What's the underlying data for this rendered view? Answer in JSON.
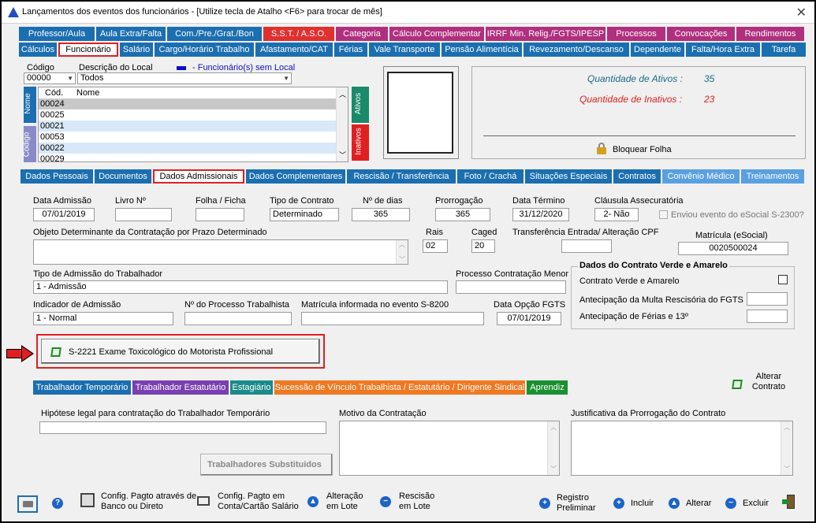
{
  "window": {
    "title": "Lançamentos dos eventos dos funcionários - [Utilize tecla de Atalho <F6> para trocar de mês]"
  },
  "tabs_row1": [
    {
      "label": "Professor/Aula",
      "color": "#1b6fb0"
    },
    {
      "label": "Aula Extra/Falta",
      "color": "#1b6fb0"
    },
    {
      "label": "Com./Pre./Grat./Bon",
      "color": "#1b6fb0"
    },
    {
      "label": "S.S.T. / A.S.O.",
      "color": "#e03030"
    },
    {
      "label": "Categoria",
      "color": "#b0307f"
    },
    {
      "label": "Cálculo Complementar",
      "color": "#b0307f"
    },
    {
      "label": "IRRF Min. Relig./FGTS/IPESP",
      "color": "#b0307f"
    },
    {
      "label": "Processos",
      "color": "#b0307f"
    },
    {
      "label": "Convocações",
      "color": "#b0307f"
    },
    {
      "label": "Rendimentos",
      "color": "#b0307f"
    }
  ],
  "tabs_row2": [
    {
      "label": "Cálculos",
      "color": "#1b6fb0"
    },
    {
      "label": "Funcionário",
      "color": "#1b6fb0",
      "active": true
    },
    {
      "label": "Salário",
      "color": "#1b6fb0"
    },
    {
      "label": "Cargo/Horário Trabalho",
      "color": "#1b6fb0"
    },
    {
      "label": "Afastamento/CAT",
      "color": "#1b6fb0"
    },
    {
      "label": "Férias",
      "color": "#1b6fb0"
    },
    {
      "label": "Vale Transporte",
      "color": "#1b6fb0"
    },
    {
      "label": "Pensão Alimentícia",
      "color": "#1b6fb0"
    },
    {
      "label": "Revezamento/Descanso",
      "color": "#1b6fb0"
    },
    {
      "label": "Dependente",
      "color": "#1b6fb0"
    },
    {
      "label": "Falta/Hora Extra",
      "color": "#1b6fb0"
    },
    {
      "label": "Tarefa",
      "color": "#1b6fb0"
    }
  ],
  "employee_list": {
    "codigo_label": "Código",
    "codigo_value": "00000",
    "local_label": "Descrição do Local",
    "local_value": "Todos",
    "legend": "- Funcionário(s) sem Local",
    "col_cod": "Cód.",
    "col_nome": "Nome",
    "side_nome": "Nome",
    "side_codigo": "Código",
    "side_ativos": "Ativos",
    "side_inativos": "Inativos",
    "rows": [
      "00024",
      "00025",
      "00021",
      "00053",
      "00022",
      "00029"
    ]
  },
  "stats": {
    "ativos_label": "Quantidade de Ativos :",
    "ativos_value": "35",
    "inativos_label": "Quantidade de Inativos :",
    "inativos_value": "23",
    "bloquear": "Bloquear Folha"
  },
  "subtabs": [
    {
      "label": "Dados Pessoais",
      "color": "#1b6fb0"
    },
    {
      "label": "Documentos",
      "color": "#1b6fb0"
    },
    {
      "label": "Dados Admissionais",
      "color": "#1b6fb0",
      "active": true
    },
    {
      "label": "Dados Complementares",
      "color": "#1b6fb0"
    },
    {
      "label": "Rescisão / Transferência",
      "color": "#1b6fb0"
    },
    {
      "label": "Foto / Crachá",
      "color": "#1b6fb0"
    },
    {
      "label": "Situações Especiais",
      "color": "#1b6fb0"
    },
    {
      "label": "Contratos",
      "color": "#1b6fb0"
    },
    {
      "label": "Convênio Médico",
      "color": "#5aa0e0"
    },
    {
      "label": "Treinamentos",
      "color": "#5aa0e0"
    }
  ],
  "form": {
    "data_admissao_label": "Data Admissão",
    "data_admissao": "07/01/2019",
    "livro_label": "Livro Nº",
    "livro": "",
    "folha_label": "Folha / Ficha",
    "folha": "",
    "tipo_contrato_label": "Tipo de Contrato",
    "tipo_contrato": "Determinado",
    "dias_label": "Nº de dias",
    "dias": "365",
    "prorrogacao_label": "Prorrogação",
    "prorrogacao": "365",
    "data_termino_label": "Data Término",
    "data_termino": "31/12/2020",
    "clausula_label": "Cláusula Assecuratória",
    "clausula": "2- Não",
    "enviou_label": "Enviou evento do eSocial S-2300?",
    "objeto_label": "Objeto Determinante da Contratação por Prazo Determinado",
    "rais_label": "Rais",
    "rais": "02",
    "caged_label": "Caged",
    "caged": "20",
    "transf_label": "Transferência Entrada/ Alteração CPF",
    "matricula_label": "Matrícula (eSocial)",
    "matricula": "0020500024",
    "tipo_admissao_label": "Tipo de Admissão do Trabalhador",
    "tipo_admissao": "1 - Admissão",
    "processo_menor_label": "Processo Contratação Menor",
    "indicador_label": "Indicador de Admissão",
    "indicador": "1 - Normal",
    "processo_trab_label": "Nº do Processo Trabalhista",
    "matricula_s8200_label": "Matrícula informada no evento S-8200",
    "data_fgts_label": "Data Opção FGTS",
    "data_fgts": "07/01/2019",
    "verde_title": "Dados do Contrato Verde e Amarelo",
    "verde_contrato": "Contrato Verde e Amarelo",
    "verde_multa": "Antecipação da Multa Rescisória do FGTS",
    "verde_ferias": "Antecipação de Férias e 13º",
    "s2221_button": "S-2221 Exame Toxicológico do Motorista Profissional"
  },
  "worker_tabs": [
    {
      "label": "Trabalhador Temporário",
      "color": "#1b6fb0"
    },
    {
      "label": "Trabalhador Estatutário",
      "color": "#7a3fb0"
    },
    {
      "label": "Estagiário",
      "color": "#1b8a8a"
    },
    {
      "label": "Sucessão de Vínculo Trabalhista / Estatutário / Dirigente Sindical",
      "color": "#f07820"
    },
    {
      "label": "Aprendiz",
      "color": "#1a9030"
    }
  ],
  "alterar_contrato": "Alterar Contrato",
  "temp": {
    "hipotese_label": "Hipótese legal para contratação do Trabalhador Temporário",
    "motivo_label": "Motivo da Contratação",
    "justificativa_label": "Justificativa da Prorrogação do Contrato",
    "substituidos_button": "Trabalhadores Substituidos"
  },
  "toolbar": {
    "config_banco": "Config. Pagto através de Banco ou Direto",
    "config_conta": "Config. Pagto em Conta/Cartão Salário",
    "alteracao_lote": "Alteração em Lote",
    "rescisao_lote": "Rescisão em Lote",
    "registro_preliminar": "Registro Preliminar",
    "incluir": "Incluir",
    "alterar": "Alterar",
    "excluir": "Excluir"
  }
}
